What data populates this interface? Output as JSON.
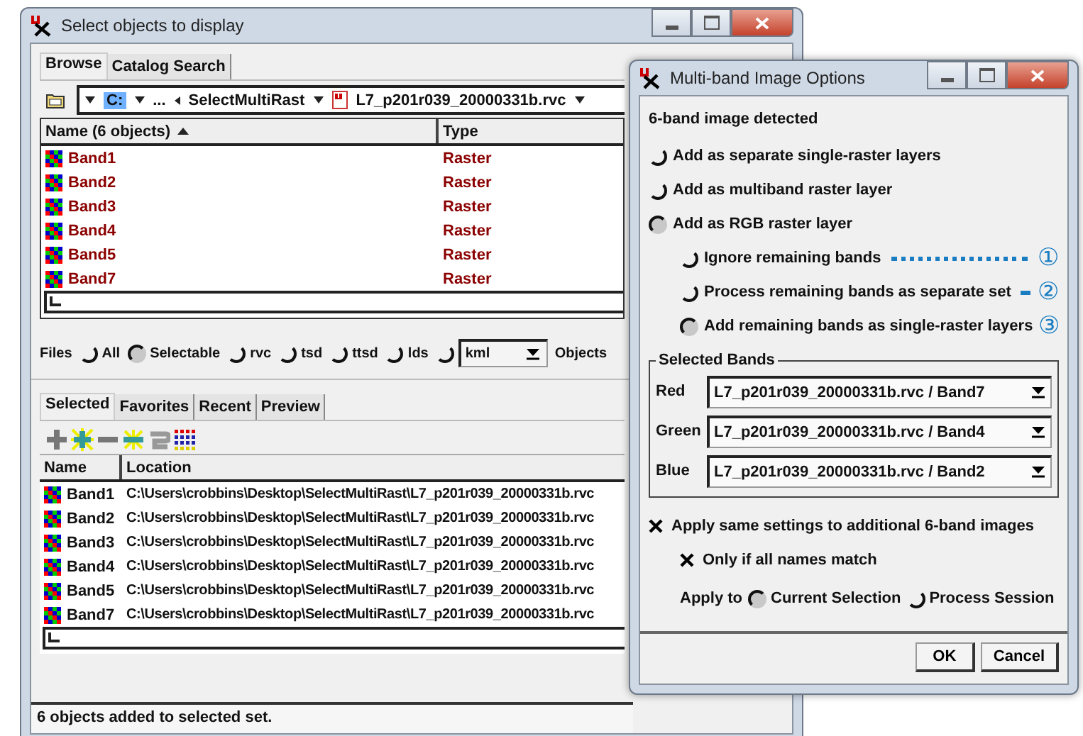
{
  "main_window": {
    "title": "Select objects to display",
    "tabs": [
      {
        "label": "Browse",
        "selected": true
      },
      {
        "label": "Catalog Search",
        "selected": false
      }
    ],
    "path_bar": {
      "drive": "C:",
      "ellipsis": "...",
      "folder": "SelectMultiRast",
      "file": "L7_p201r039_20000331b.rvc"
    },
    "object_list": {
      "columns": [
        "Name  (6 objects)",
        "Type"
      ],
      "rows": [
        {
          "name": "Band1",
          "type": "Raster"
        },
        {
          "name": "Band2",
          "type": "Raster"
        },
        {
          "name": "Band3",
          "type": "Raster"
        },
        {
          "name": "Band4",
          "type": "Raster"
        },
        {
          "name": "Band5",
          "type": "Raster"
        },
        {
          "name": "Band7",
          "type": "Raster"
        }
      ]
    },
    "file_filter": {
      "label": "Files",
      "options": [
        {
          "kind": "radio",
          "label": "All",
          "selected": false
        },
        {
          "kind": "radio",
          "label": "Selectable",
          "selected": true
        },
        {
          "kind": "radio",
          "label": "rvc",
          "selected": false
        },
        {
          "kind": "radio",
          "label": "tsd",
          "selected": false
        },
        {
          "kind": "radio",
          "label": "ttsd",
          "selected": false
        },
        {
          "kind": "radio",
          "label": "lds",
          "selected": false
        },
        {
          "kind": "dropdown",
          "value": "kml",
          "selected": false
        }
      ],
      "objects_label": "Objects"
    },
    "selection_tabs": [
      {
        "label": "Selected",
        "selected": true
      },
      {
        "label": "Favorites",
        "selected": false
      },
      {
        "label": "Recent",
        "selected": false
      },
      {
        "label": "Preview",
        "selected": false
      }
    ],
    "selected_list": {
      "columns": [
        "Name",
        "Location"
      ],
      "rows": [
        {
          "name": "Band1",
          "location": "C:\\Users\\crobbins\\Desktop\\SelectMultiRast\\L7_p201r039_20000331b.rvc"
        },
        {
          "name": "Band2",
          "location": "C:\\Users\\crobbins\\Desktop\\SelectMultiRast\\L7_p201r039_20000331b.rvc"
        },
        {
          "name": "Band3",
          "location": "C:\\Users\\crobbins\\Desktop\\SelectMultiRast\\L7_p201r039_20000331b.rvc"
        },
        {
          "name": "Band4",
          "location": "C:\\Users\\crobbins\\Desktop\\SelectMultiRast\\L7_p201r039_20000331b.rvc"
        },
        {
          "name": "Band5",
          "location": "C:\\Users\\crobbins\\Desktop\\SelectMultiRast\\L7_p201r039_20000331b.rvc"
        },
        {
          "name": "Band7",
          "location": "C:\\Users\\crobbins\\Desktop\\SelectMultiRast\\L7_p201r039_20000331b.rvc"
        }
      ]
    },
    "status_bar": "6 objects added to selected set."
  },
  "dialog": {
    "title": "Multi-band Image Options",
    "heading": "6-band image detected",
    "add_modes": [
      {
        "label": "Add as separate single-raster layers",
        "selected": false
      },
      {
        "label": "Add as multiband raster layer",
        "selected": false
      },
      {
        "label": "Add as RGB raster layer",
        "selected": true
      }
    ],
    "remaining_modes": [
      {
        "label": "Ignore remaining bands",
        "selected": false,
        "leader": true,
        "callout": "①"
      },
      {
        "label": "Process remaining bands as separate set",
        "selected": false,
        "leader": true,
        "callout": "②"
      },
      {
        "label": "Add remaining bands as single-raster layers",
        "selected": true,
        "leader": false,
        "callout": "③"
      }
    ],
    "selected_bands": {
      "title": "Selected Bands",
      "rows": [
        {
          "label": "Red",
          "value": "L7_p201r039_20000331b.rvc / Band7"
        },
        {
          "label": "Green",
          "value": "L7_p201r039_20000331b.rvc / Band4"
        },
        {
          "label": "Blue",
          "value": "L7_p201r039_20000331b.rvc / Band2"
        }
      ]
    },
    "apply_same": {
      "label": "Apply same settings to additional 6-band images",
      "checked": true
    },
    "only_if_match": {
      "label": "Only if all names match",
      "checked": true
    },
    "apply_to": {
      "label": "Apply to",
      "options": [
        {
          "label": "Current Selection",
          "selected": true
        },
        {
          "label": "Process Session",
          "selected": false
        }
      ]
    },
    "buttons": [
      "OK",
      "Cancel"
    ]
  }
}
